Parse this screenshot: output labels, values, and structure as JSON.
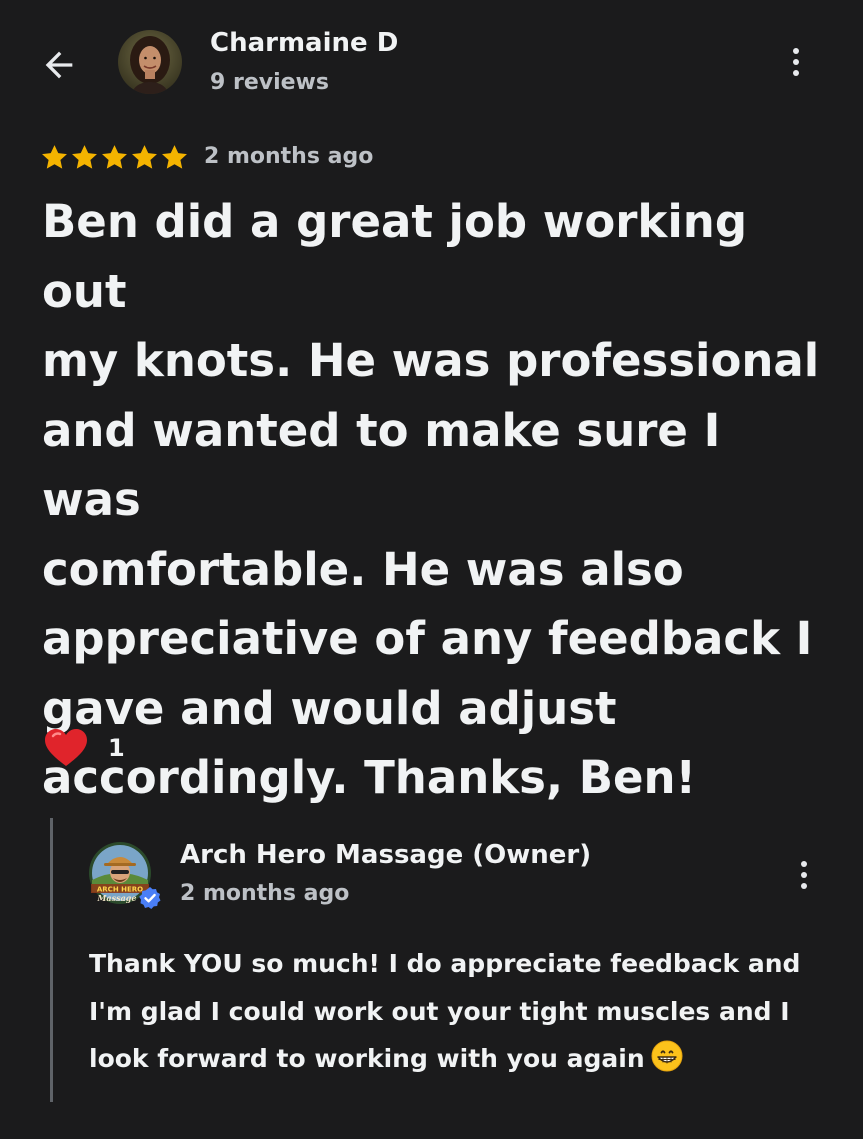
{
  "reviewer": {
    "name": "Charmaine D",
    "review_count": "9 reviews"
  },
  "review": {
    "rating": 5,
    "max_rating": 5,
    "time_ago": "2 months ago",
    "text": "Ben did a great job working out\nmy knots.  He was professional\nand wanted to make sure I was\ncomfortable.  He was also\nappreciative of any feedback I\ngave and would adjust\naccordingly.  Thanks, Ben!",
    "reaction_count": "1"
  },
  "reply": {
    "owner_name": "Arch Hero Massage (Owner)",
    "time_ago": "2 months ago",
    "text": "Thank YOU so much! I do appreciate feedback and\nI'm glad I could work out your tight muscles and I\nlook forward to working with you again",
    "avatar_logo_text": "ARCH HERO Massage",
    "trailing_emoji": "grinning-face"
  },
  "icons": {
    "back": "arrow-left-icon",
    "more": "more-vertical-icon",
    "star": "star-icon",
    "reaction": "red-heart-icon",
    "verified": "verified-check-icon"
  },
  "colors": {
    "background": "#1b1b1c",
    "text_primary": "#f1f3f4",
    "text_secondary": "#bdc1c6",
    "star": "#f5b400",
    "heart": "#e0242b",
    "verified": "#4a7ff7",
    "reply_bar": "#5f6368"
  }
}
